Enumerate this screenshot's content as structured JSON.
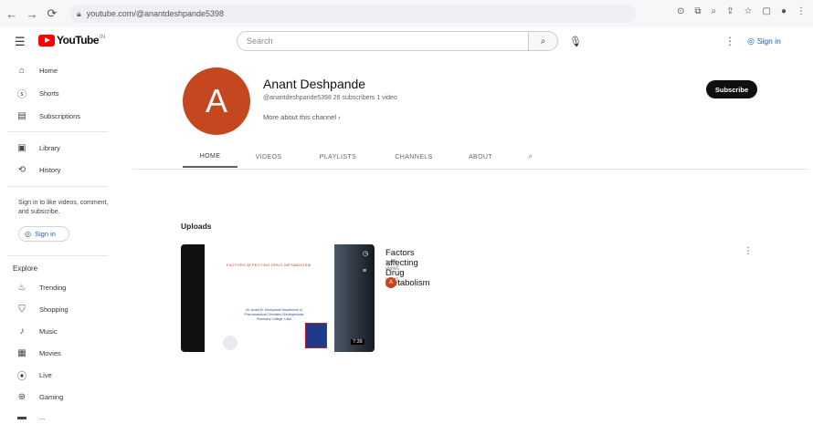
{
  "browser": {
    "url": "youtube.com/@anantdeshpande5398",
    "icons": [
      "back-icon",
      "forward-icon",
      "reload-icon",
      "lock-icon",
      "extensions-icon",
      "profile-icon"
    ]
  },
  "header": {
    "logo_text": "YouTube",
    "logo_region": "IN",
    "search_placeholder": "Search",
    "signin_label": "Sign in"
  },
  "sidebar": {
    "items_top": [
      {
        "icon": "home-icon",
        "label": "Home"
      },
      {
        "icon": "shorts-icon",
        "label": "Shorts"
      },
      {
        "icon": "subscriptions-icon",
        "label": "Subscriptions"
      }
    ],
    "items_lib": [
      {
        "icon": "library-icon",
        "label": "Library"
      },
      {
        "icon": "history-icon",
        "label": "History"
      }
    ],
    "signin_prompt": "Sign in to like videos, comment, and subscribe.",
    "signin_label": "Sign in",
    "explore_heading": "Explore",
    "explore_items": [
      {
        "icon": "trending-icon",
        "label": "Trending"
      },
      {
        "icon": "shopping-icon",
        "label": "Shopping"
      },
      {
        "icon": "music-icon",
        "label": "Music"
      },
      {
        "icon": "movies-icon",
        "label": "Movies"
      },
      {
        "icon": "live-icon",
        "label": "Live"
      },
      {
        "icon": "gaming-icon",
        "label": "Gaming"
      },
      {
        "icon": "news-icon",
        "label": "..."
      }
    ]
  },
  "channel": {
    "avatar_letter": "A",
    "name": "Anant Deshpande",
    "meta": "@anantdeshpande5398  26 subscribers  1 video",
    "more_label": "More about this channel",
    "subscribe_label": "Subscribe",
    "tabs": [
      "HOME",
      "VIDEOS",
      "PLAYLISTS",
      "CHANNELS",
      "ABOUT"
    ],
    "active_tab": "HOME"
  },
  "uploads": {
    "heading": "Uploads",
    "video": {
      "title": "Factors affecting Drug Metabolism",
      "meta": "2.9K views • 2 years ago",
      "duration": "7:39",
      "channel_letter": "A",
      "slide_title": "FACTORS AFFECTING DRUG METABOLISM",
      "slide_sub": "Mr. Anant M. Deshpande Department of Pharmaceutical Chemistry Shivlingeshwar Pharmacy College, Latur"
    }
  },
  "colors": {
    "accent_blue": "#065fd4",
    "brand_red": "#ff0000",
    "avatar": "#c4471f"
  }
}
